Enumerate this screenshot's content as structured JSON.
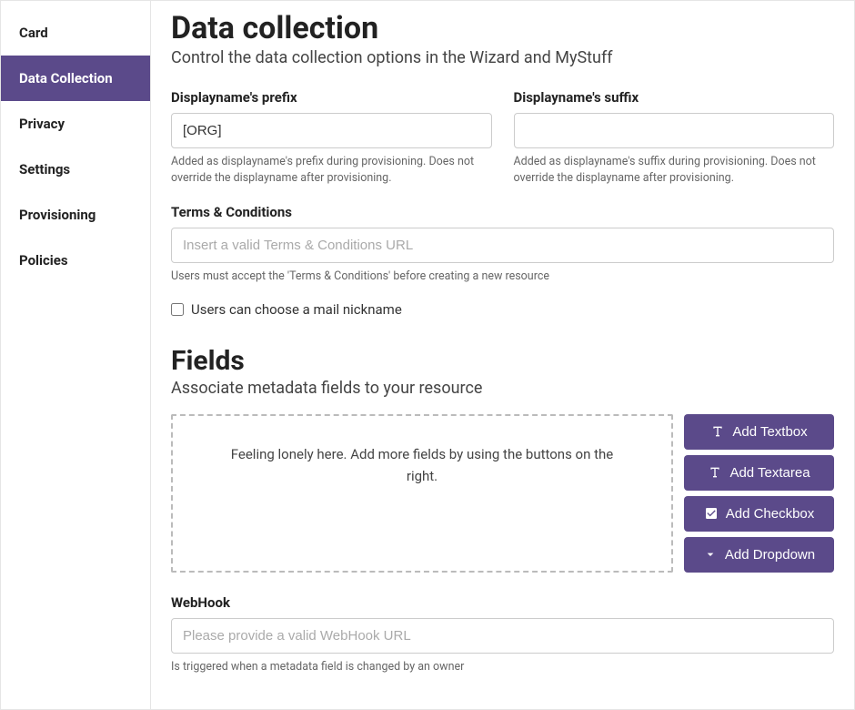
{
  "sidebar": {
    "items": [
      {
        "label": "Card"
      },
      {
        "label": "Data Collection"
      },
      {
        "label": "Privacy"
      },
      {
        "label": "Settings"
      },
      {
        "label": "Provisioning"
      },
      {
        "label": "Policies"
      }
    ]
  },
  "page": {
    "title": "Data collection",
    "subtitle": "Control the data collection options in the Wizard and MyStuff"
  },
  "prefix": {
    "label": "Displayname's prefix",
    "value": "[ORG]",
    "help": "Added as displayname's prefix during provisioning. Does not override the displayname after provisioning."
  },
  "suffix": {
    "label": "Displayname's suffix",
    "value": "",
    "help": "Added as displayname's suffix during provisioning. Does not override the displayname after provisioning."
  },
  "terms": {
    "label": "Terms & Conditions",
    "placeholder": "Insert a valid Terms & Conditions URL",
    "help": "Users must accept the 'Terms & Conditions' before creating a new resource"
  },
  "nickname": {
    "label": "Users can choose a mail nickname"
  },
  "fields": {
    "title": "Fields",
    "subtitle": "Associate metadata fields to your resource",
    "empty": "Feeling lonely here. Add more fields by using the buttons on the right.",
    "buttons": {
      "textbox": "Add Textbox",
      "textarea": "Add Textarea",
      "checkbox": "Add Checkbox",
      "dropdown": "Add Dropdown"
    }
  },
  "webhook": {
    "label": "WebHook",
    "placeholder": "Please provide a valid WebHook URL",
    "help": "Is triggered when a metadata field is changed by an owner"
  }
}
